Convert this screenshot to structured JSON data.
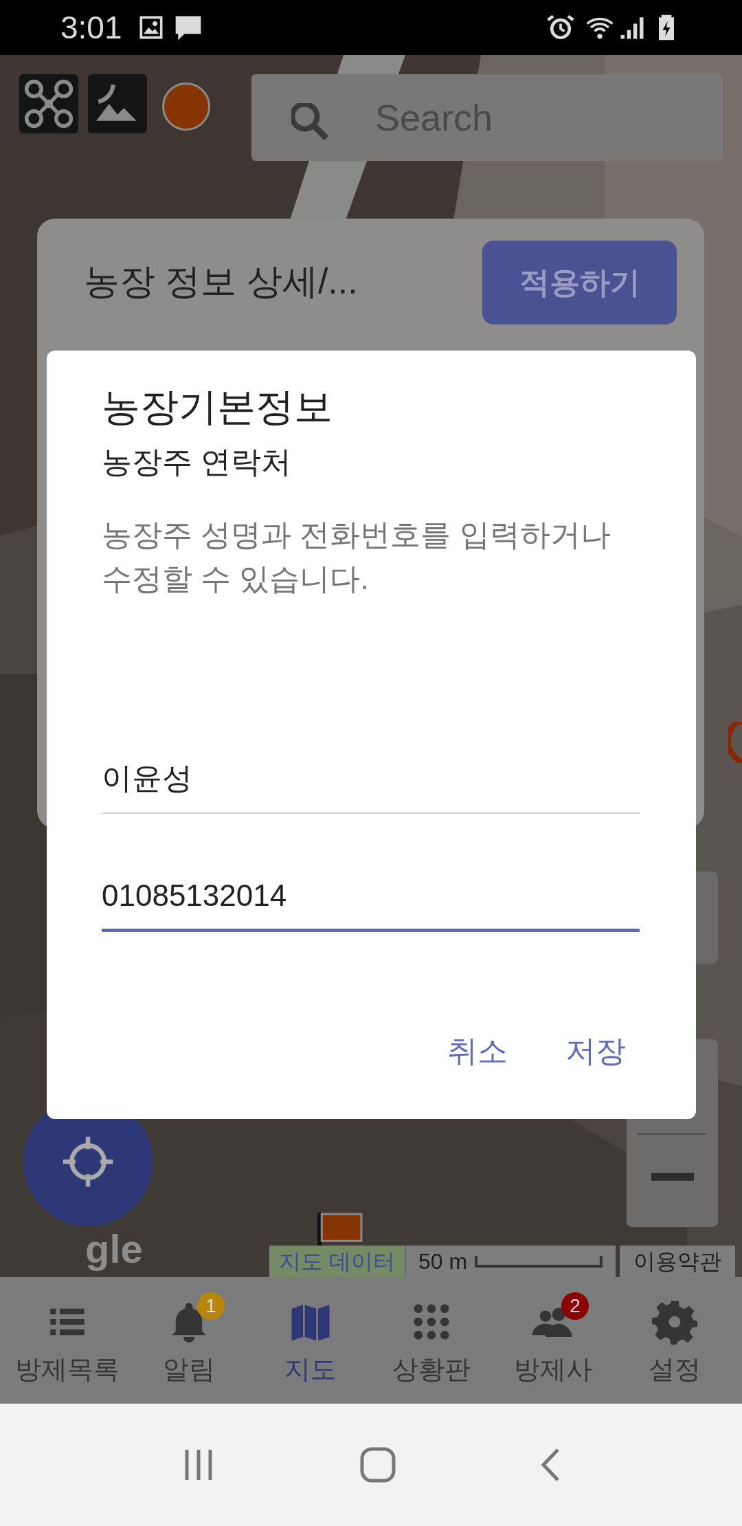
{
  "status_bar": {
    "time": "3:01"
  },
  "map": {
    "search": {
      "placeholder": "Search"
    },
    "logo_text": "gle",
    "attribution": {
      "data_link": "지도 데이터",
      "scale": "50 m",
      "terms_link": "이용약관"
    }
  },
  "farm_card": {
    "title": "농장 정보 상세/...",
    "apply_button": "적용하기"
  },
  "dialog": {
    "title": "농장기본정보",
    "subtitle": "농장주 연락처",
    "description": "농장주 성명과 전화번호를 입력하거나 수정할 수 있습니다.",
    "fields": [
      {
        "value": "이윤성",
        "focused": false
      },
      {
        "value": "01085132014",
        "focused": true
      }
    ],
    "buttons": [
      "취소",
      "저장"
    ]
  },
  "bottom_nav": [
    {
      "kind": "list",
      "label": "방제목록",
      "selected": false
    },
    {
      "kind": "bell",
      "label": "알림",
      "selected": false,
      "badge": "1",
      "color": "#b8860b"
    },
    {
      "kind": "map",
      "label": "지도",
      "selected": true
    },
    {
      "kind": "grid",
      "label": "상황판",
      "selected": false
    },
    {
      "kind": "people",
      "label": "방제사",
      "selected": false,
      "badge": "2",
      "color": "#8b0000"
    },
    {
      "kind": "gear",
      "label": "설정",
      "selected": false
    }
  ]
}
